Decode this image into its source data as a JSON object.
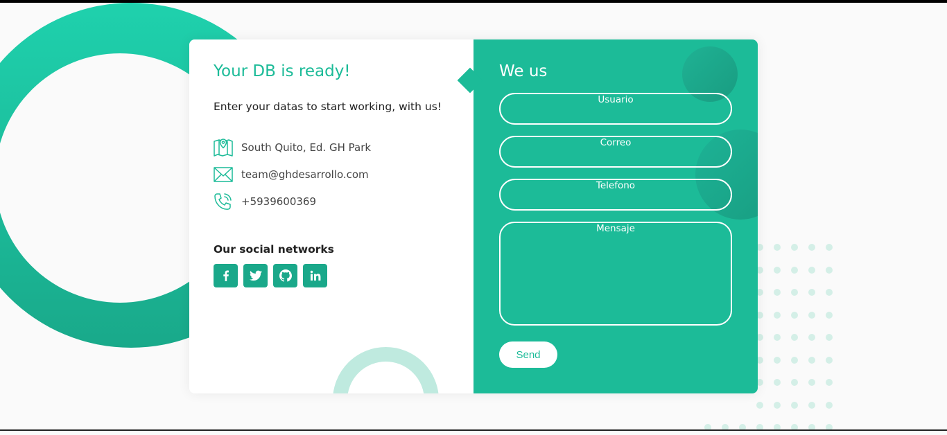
{
  "info": {
    "title": "Your DB is ready!",
    "text": "Enter your datas to start working, with us!",
    "address": "South Quito, Ed. GH Park",
    "email": "team@ghdesarrollo.com",
    "phone": "+5939600369",
    "social_title": "Our social networks",
    "social": [
      {
        "icon": "facebook-icon"
      },
      {
        "icon": "twitter-icon"
      },
      {
        "icon": "github-icon"
      },
      {
        "icon": "linkedin-icon"
      }
    ]
  },
  "form": {
    "title": "We us",
    "user_label": "Usuario",
    "email_label": "Correo",
    "phone_label": "Telefono",
    "message_label": "Mensaje",
    "send_label": "Send"
  },
  "colors": {
    "accent": "#1cbb98",
    "social_button": "#1aa88a",
    "background": "#fafafa"
  }
}
